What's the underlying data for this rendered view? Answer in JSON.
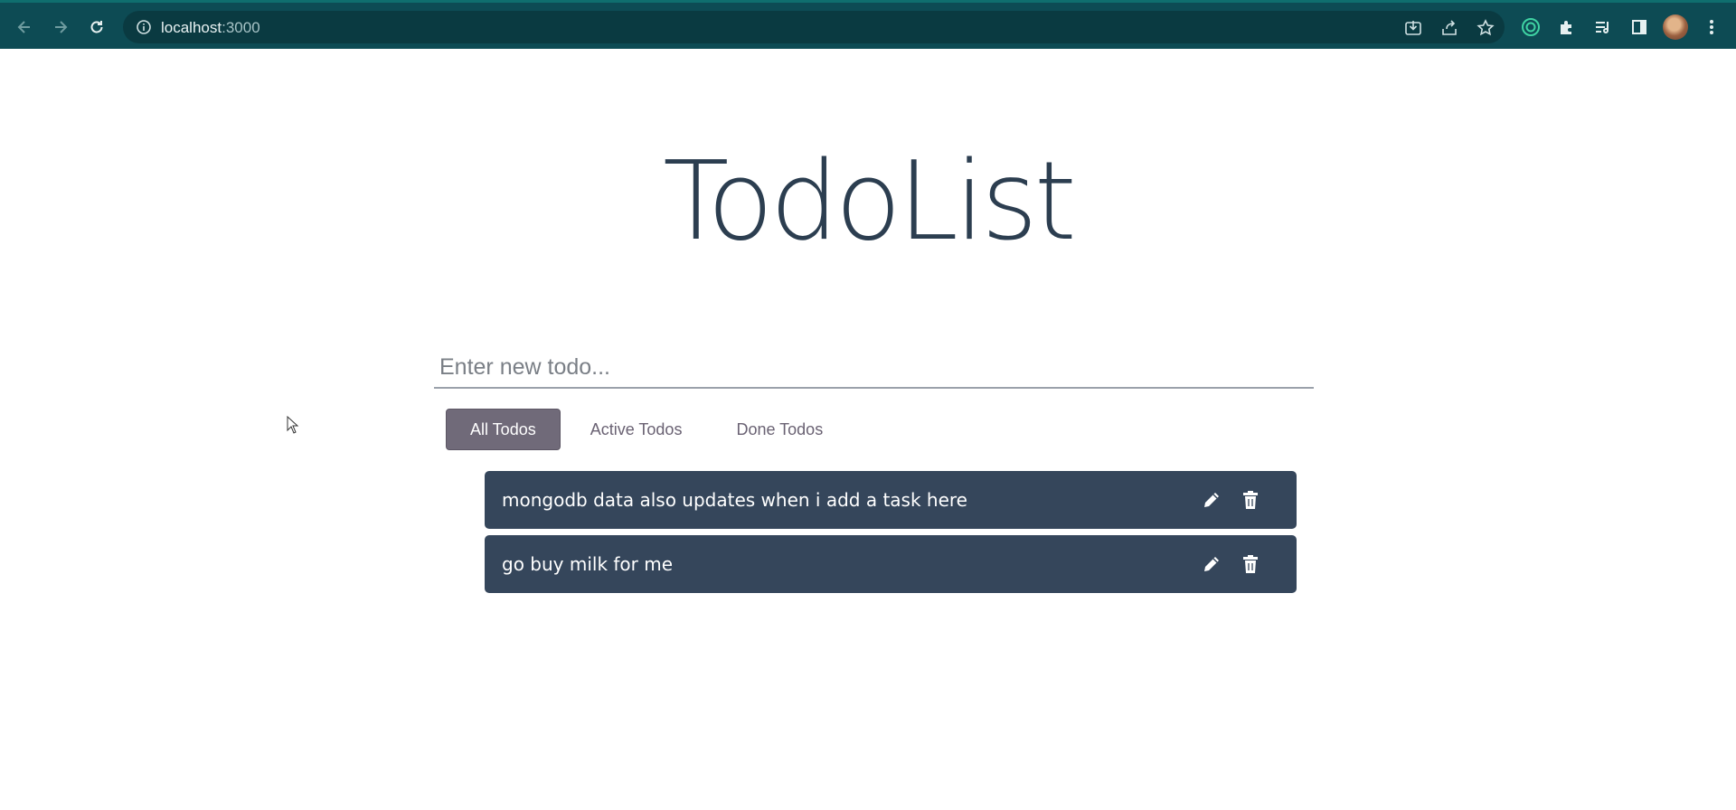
{
  "browser": {
    "url_host": "localhost",
    "url_port": ":3000",
    "chrome_color": "#0d4b54",
    "icons": [
      "back-icon",
      "forward-icon",
      "reload-icon",
      "info-icon",
      "install-icon",
      "share-icon",
      "bookmark-star-icon",
      "extension-ring-icon",
      "puzzle-extensions-icon",
      "reading-list-icon",
      "side-panel-icon",
      "profile-avatar",
      "more-menu-icon"
    ]
  },
  "app": {
    "title": "TodoList",
    "input_placeholder": "Enter new todo...",
    "filters": [
      {
        "label": "All Todos",
        "active": true
      },
      {
        "label": "Active Todos",
        "active": false
      },
      {
        "label": "Done Todos",
        "active": false
      }
    ],
    "todos": [
      {
        "text": "mongodb data also updates when i add a task here"
      },
      {
        "text": "go buy milk for me"
      }
    ],
    "colors": {
      "title": "#2c3e50",
      "todo_bg": "#35465b",
      "active_filter_bg": "#706a79"
    }
  }
}
